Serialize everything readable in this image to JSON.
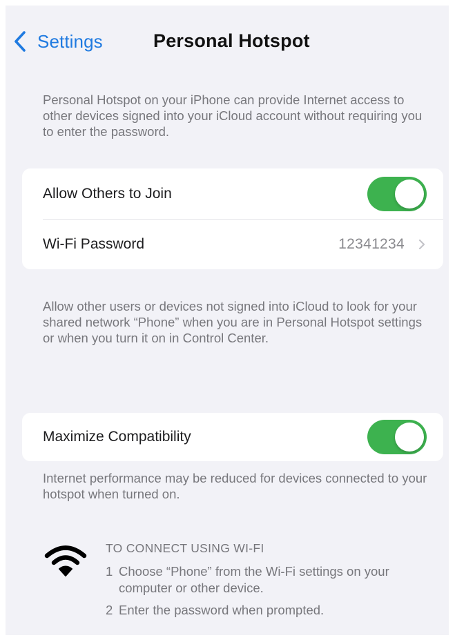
{
  "nav": {
    "back_label": "Settings",
    "title": "Personal Hotspot"
  },
  "intro_note": "Personal Hotspot on your iPhone can provide Internet access to other devices signed into your iCloud account without requiring you to enter the password.",
  "hotspot_group": {
    "allow_join": {
      "label": "Allow Others to Join",
      "toggle_on": true
    },
    "wifi_password": {
      "label": "Wi-Fi Password",
      "value": "12341234",
      "chevron_icon": "chevron-right-icon"
    }
  },
  "allow_note": "Allow other users or devices not signed into iCloud to look for your shared network “Phone” when you are in Personal Hotspot settings or when you turn it on in Control Center.",
  "compat_group": {
    "maximize": {
      "label": "Maximize Compatibility",
      "toggle_on": true
    }
  },
  "compat_note": "Internet performance may be reduced for devices connected to your hotspot when turned on.",
  "instructions": {
    "icon": "wifi-icon",
    "heading": "TO CONNECT USING WI-FI",
    "steps": [
      {
        "number": "1",
        "text": "Choose “Phone” from the Wi-Fi settings on your computer or other device."
      },
      {
        "number": "2",
        "text": "Enter the password when prompted."
      }
    ]
  },
  "colors": {
    "accent_blue": "#1f7ae0",
    "toggle_on_green": "#3db24f",
    "background": "#f2f2f7",
    "card": "#ffffff",
    "secondary_text": "#77777c"
  }
}
